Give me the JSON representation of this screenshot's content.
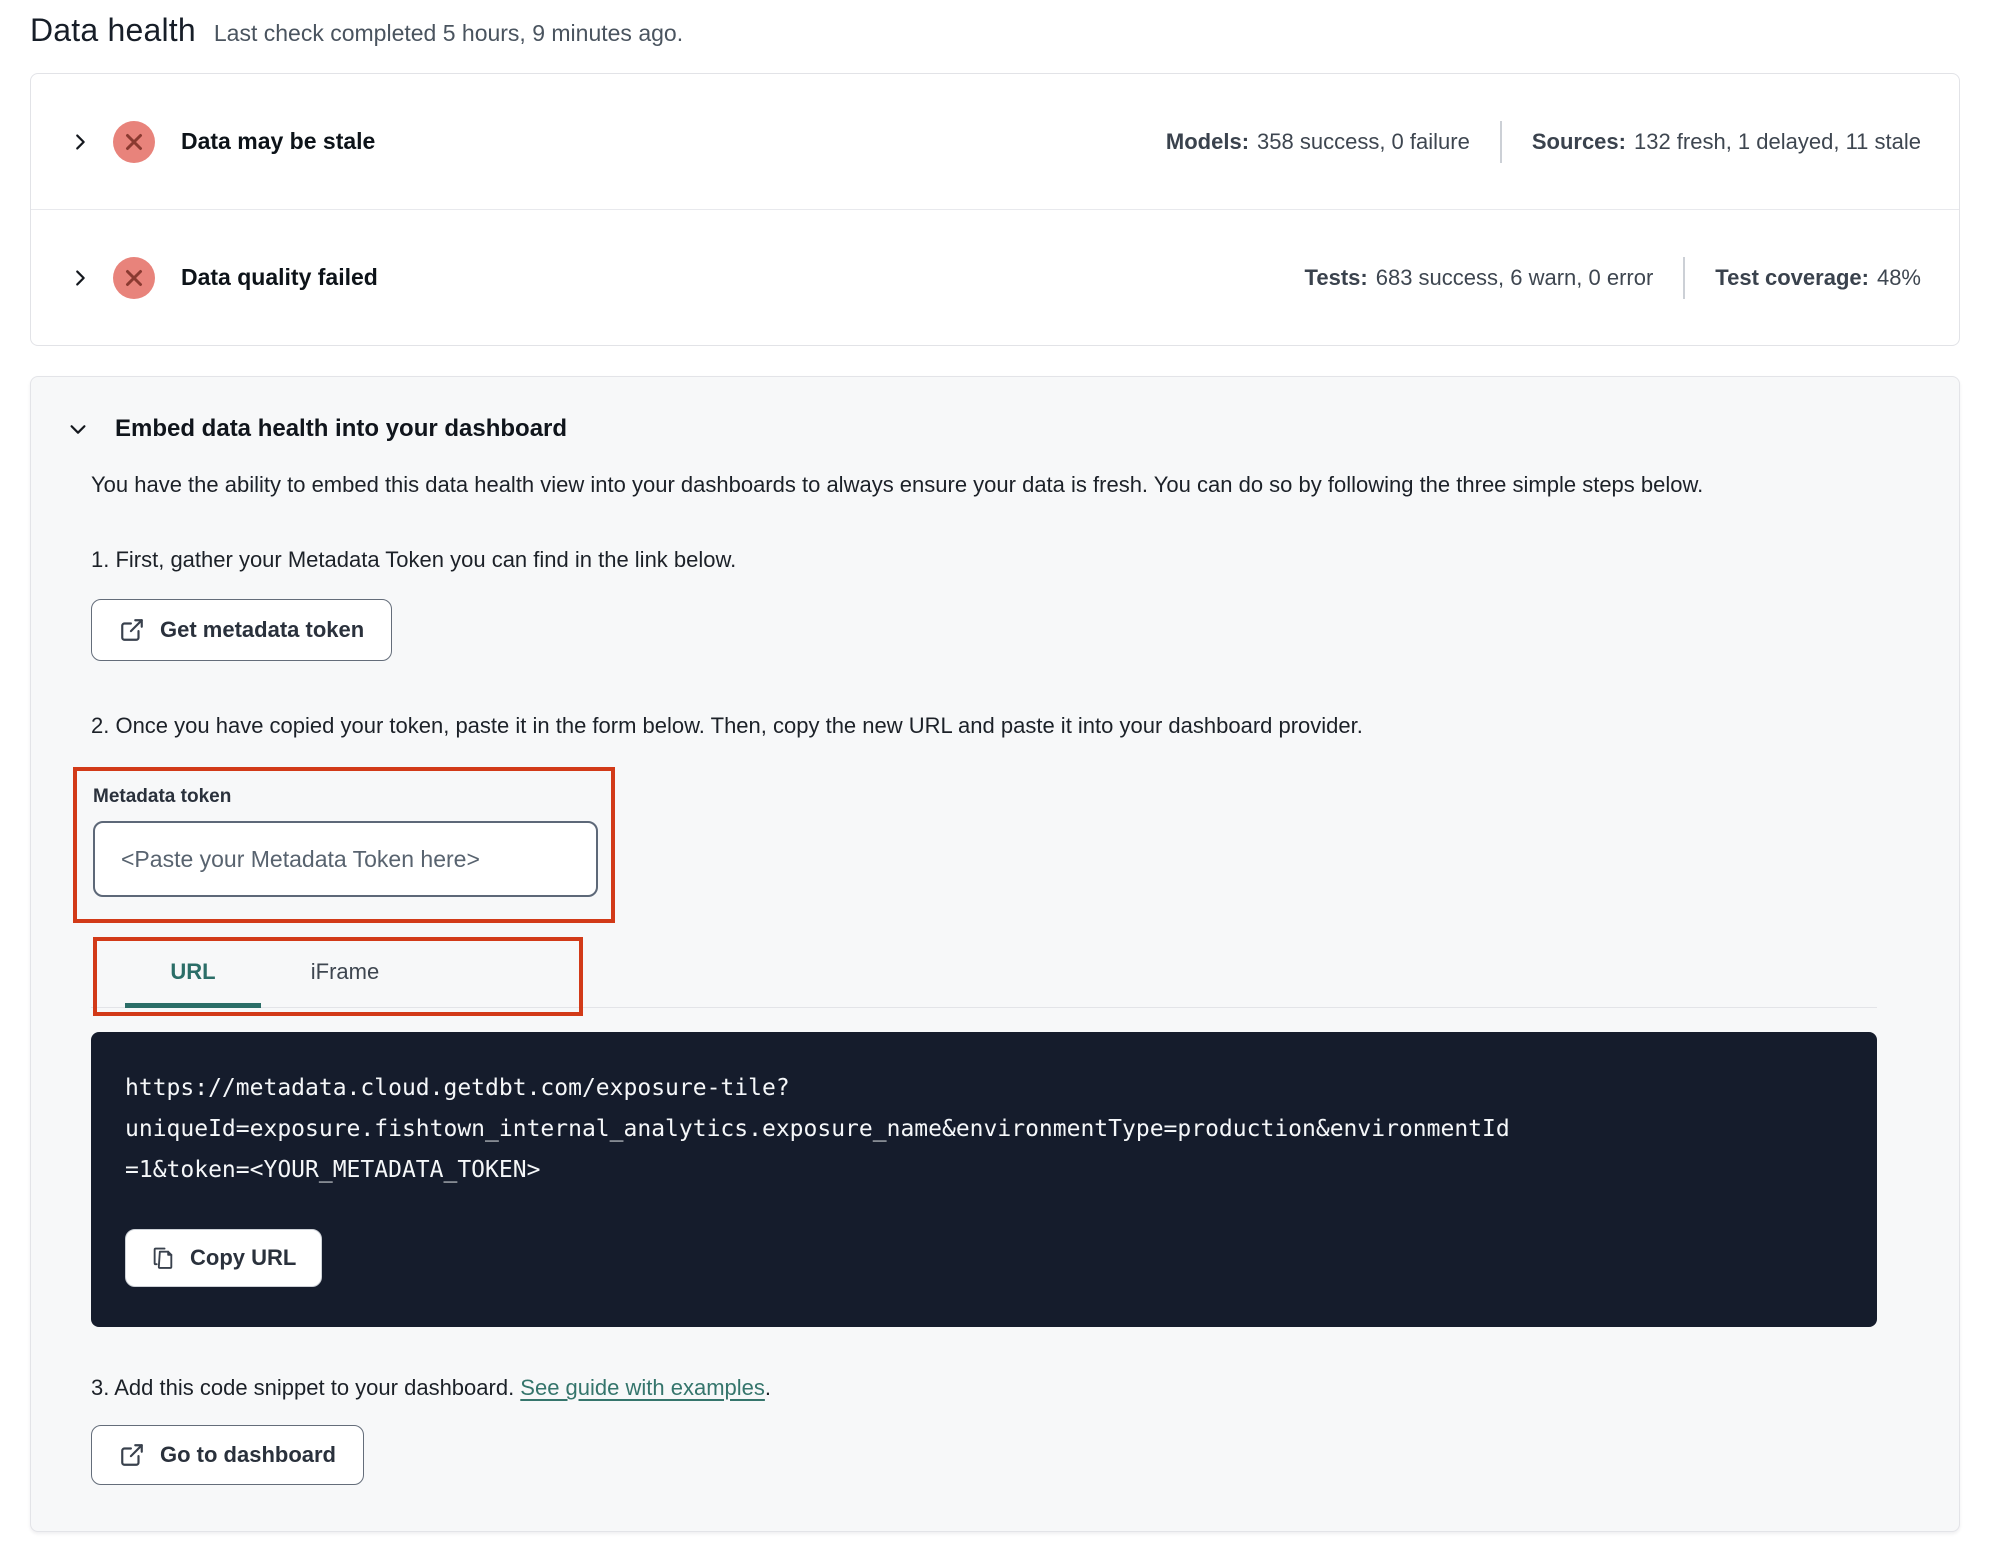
{
  "header": {
    "title": "Data health",
    "subtitle": "Last check completed 5 hours, 9 minutes ago."
  },
  "status_rows": [
    {
      "title": "Data may be stale",
      "status_icon": "error-x-circle",
      "stats": [
        {
          "label": "Models:",
          "value": "358 success, 0 failure"
        },
        {
          "label": "Sources:",
          "value": "132 fresh, 1 delayed, 11 stale"
        }
      ]
    },
    {
      "title": "Data quality failed",
      "status_icon": "error-x-circle",
      "stats": [
        {
          "label": "Tests:",
          "value": "683 success, 6 warn, 0 error"
        },
        {
          "label": "Test coverage:",
          "value": "48%"
        }
      ]
    }
  ],
  "embed": {
    "title": "Embed data health into your dashboard",
    "description": "You have the ability to embed this data health view into your dashboards to always ensure your data is fresh. You can do so by following the three simple steps below.",
    "step1": "1. First, gather your Metadata Token you can find in the link below.",
    "get_token_button": "Get metadata token",
    "step2": "2. Once you have copied your token, paste it in the form below. Then, copy the new URL and paste it into your dashboard provider.",
    "token_field": {
      "label": "Metadata token",
      "placeholder": "<Paste your Metadata Token here>"
    },
    "tabs": [
      {
        "label": "URL",
        "active": true
      },
      {
        "label": "iFrame",
        "active": false
      }
    ],
    "code_lines": [
      "https://metadata.cloud.getdbt.com/exposure-tile?",
      "uniqueId=exposure.fishtown_internal_analytics.exposure_name&environmentType=production&environmentId",
      "=1&token=<YOUR_METADATA_TOKEN>"
    ],
    "copy_button": "Copy URL",
    "step3_text": "3. Add this code snippet to your dashboard. ",
    "step3_link": "See guide with examples",
    "step3_suffix": ".",
    "dashboard_button": "Go to dashboard"
  },
  "colors": {
    "annotation_red": "#d23a18",
    "error_badge_fill": "#e8837b",
    "error_badge_x": "#8a3a31",
    "accent_teal": "#2b6e68",
    "link_teal": "#35756c",
    "code_background": "#151c2c",
    "card_background": "#f7f8f9"
  }
}
